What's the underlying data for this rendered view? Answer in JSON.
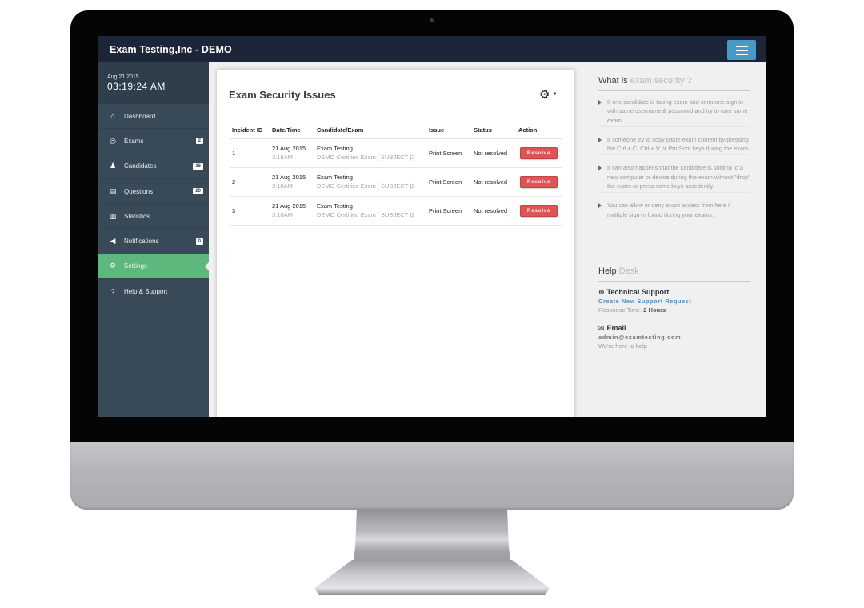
{
  "app": {
    "title": "Exam Testing,Inc - DEMO",
    "menu_icon": "hamburger-menu-icon"
  },
  "clock": {
    "date": "Aug 21 2015",
    "time": "03:19:24 AM"
  },
  "sidebar": {
    "items": [
      {
        "label": "Dashboard",
        "icon": "home-icon",
        "glyph": "⌂",
        "badge": null,
        "active": false
      },
      {
        "label": "Exams",
        "icon": "target-icon",
        "glyph": "◎",
        "badge": "2",
        "active": false
      },
      {
        "label": "Candidates",
        "icon": "user-icon",
        "glyph": "♟",
        "badge": "16",
        "active": false
      },
      {
        "label": "Questions",
        "icon": "document-icon",
        "glyph": "▤",
        "badge": "20",
        "active": false
      },
      {
        "label": "Statistics",
        "icon": "bar-chart-icon",
        "glyph": "▥",
        "badge": null,
        "active": false
      },
      {
        "label": "Notifications",
        "icon": "megaphone-icon",
        "glyph": "◀",
        "badge": "0",
        "active": false
      },
      {
        "label": "Settings",
        "icon": "gear-icon",
        "glyph": "⚙",
        "badge": null,
        "active": true
      },
      {
        "label": "Help & Support",
        "icon": "question-icon",
        "glyph": "?",
        "badge": null,
        "active": false
      }
    ]
  },
  "main": {
    "title": "Exam Security Issues",
    "settings_glyph": "⚙",
    "caret_glyph": "▼",
    "columns": [
      "Incident ID",
      "Date/Time",
      "Candidate/Exam",
      "Issue",
      "Status",
      "Action"
    ],
    "rows": [
      {
        "id": "1",
        "date": "21 Aug 2015",
        "time": "3:18AM",
        "candidate": "Exam Testing",
        "exam": "DEMO Certified Exam [ SUBJECT ]2",
        "issue": "Print Screen",
        "status": "Not resolved",
        "action": "Resolve"
      },
      {
        "id": "2",
        "date": "21 Aug 2015",
        "time": "3:18AM",
        "candidate": "Exam Testing",
        "exam": "DEMO Certified Exam [ SUBJECT ]2",
        "issue": "Print Screen",
        "status": "Not resolved",
        "action": "Resolve"
      },
      {
        "id": "3",
        "date": "21 Aug 2015",
        "time": "3:18AM",
        "candidate": "Exam Testing",
        "exam": "DEMO Certified Exam [ SUBJECT ]2",
        "issue": "Print Screen",
        "status": "Not resolved",
        "action": "Resolve"
      }
    ]
  },
  "info": {
    "heading_strong": "What is",
    "heading_light": "exam security ?",
    "bullets": [
      "If one candidate is taking exam and someone sign in with same username & password and try to take same exam.",
      "If someone try to copy paste exam content by pressing the Ctrl + C, Ctrl + V or PrntScrn keys during the exam.",
      "It can also happens that the candidate is shifting to a new computer or device during the exam without \"drop\" the exam or press some keys accedently.",
      "You can allow or deny exam access from here if multiple sign-in found during your exams."
    ]
  },
  "helpdesk": {
    "heading_strong": "Help",
    "heading_light": "Desk",
    "support": {
      "label": "Technical Support",
      "link": "Create New Support Request",
      "response_prefix": "Response Time:",
      "response_value": "2 Hours"
    },
    "email": {
      "label": "Email",
      "address": "admin@examtesting.com",
      "note": "We're here to help"
    }
  },
  "colors": {
    "topbar": "#1c2638",
    "sidebar": "#384a58",
    "active": "#5cb87c",
    "menu_button": "#4a98c6",
    "danger": "#dd5556",
    "link": "#4a8ec5"
  }
}
